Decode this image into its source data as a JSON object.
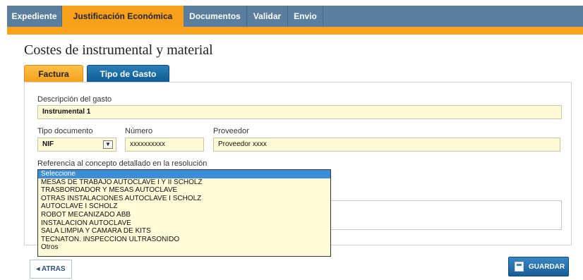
{
  "nav": {
    "tabs": [
      {
        "label": "Expediente"
      },
      {
        "label": "Justificación Económica"
      },
      {
        "label": "Documentos"
      },
      {
        "label": "Validar"
      },
      {
        "label": "Envio"
      }
    ]
  },
  "page": {
    "title": "Costes de instrumental y material"
  },
  "subtabs": [
    {
      "label": "Factura"
    },
    {
      "label": "Tipo de Gasto"
    }
  ],
  "form": {
    "descripcion_label": "Descripción del gasto",
    "descripcion_value": "Instrumental 1",
    "tipo_documento_label": "Tipo documento",
    "tipo_documento_value": "NIF",
    "numero_label": "Número",
    "numero_value": "xxxxxxxxxx",
    "proveedor_label": "Proveedor",
    "proveedor_value": "Proveedor xxxx",
    "referencia_label": "Referencia al concepto detallado en la resolución"
  },
  "dropdown": {
    "options": [
      "Seleccione",
      "MESAS DE TRABAJO AUTOCLAVE I Y II SCHOLZ",
      "TRASBORDADOR Y MESAS AUTOCLAVE",
      "OTRAS INSTALACIONES AUTOCLAVE I SCHOLZ",
      "AUTOCLAVE I SCHOLZ",
      "ROBOT MECANIZADO ABB",
      "INSTALACION AUTOCLAVE",
      "SALA LIMPIA Y CAMARA DE KITS",
      "TECNATON. INSPECCION ULTRASONIDO",
      "Otros"
    ],
    "selected": "Seleccione"
  },
  "buttons": {
    "back_label": "ATRAS",
    "back_icon": "chevron-left-icon",
    "save_label": "GUARDAR",
    "save_icon": "save-icon"
  },
  "colors": {
    "nav_bg": "#5b7d9e",
    "accent": "#f8a31b",
    "field_bg": "#fefad5",
    "primary_blue": "#165e98"
  }
}
